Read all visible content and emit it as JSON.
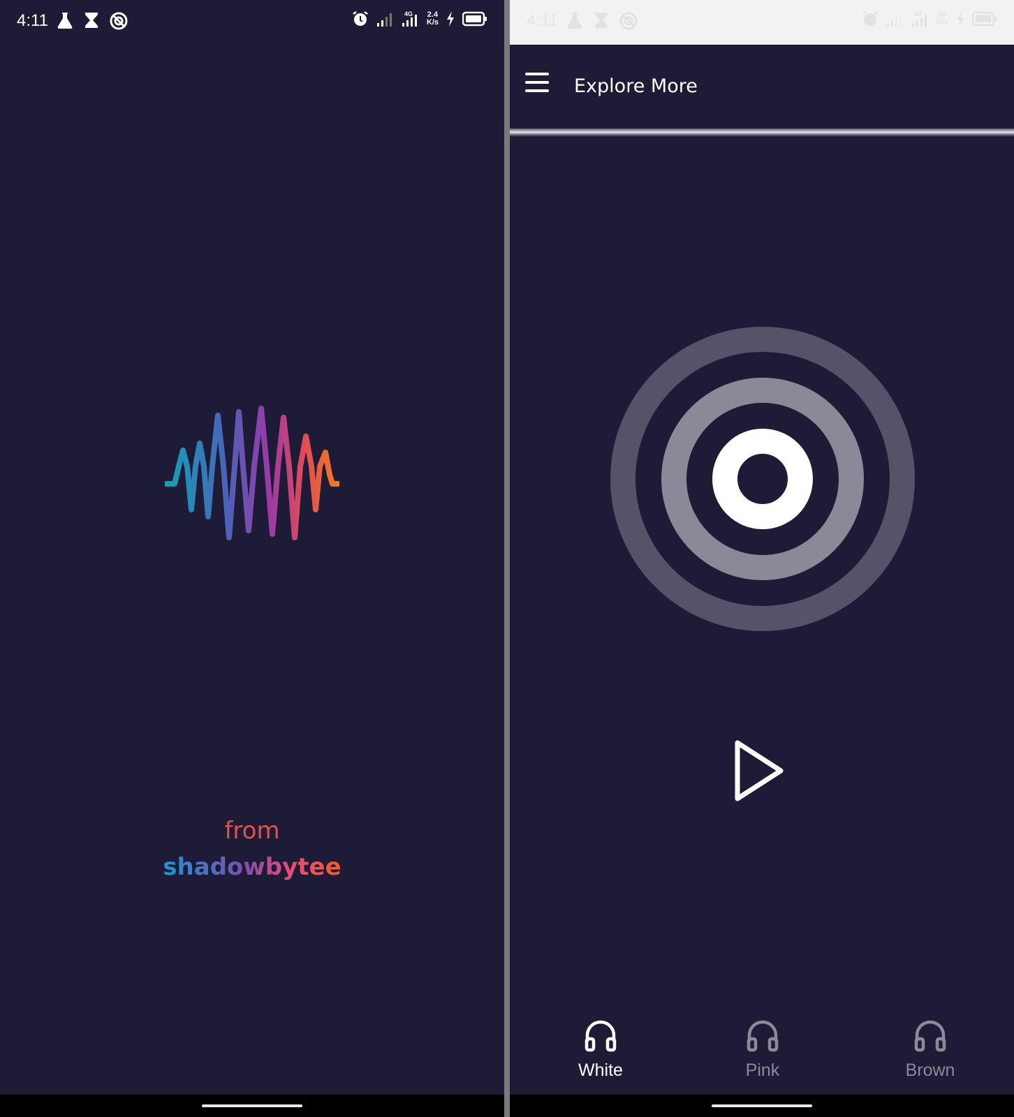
{
  "status_bar_left": {
    "time": "4:11",
    "icons": [
      "flask-icon",
      "hourglass-icon",
      "no-disturb-icon"
    ],
    "right_icons": [
      "alarm-icon",
      "signal-icon",
      "signal-4g-icon",
      "charging-icon",
      "battery-icon"
    ],
    "speed_line1": "2.4",
    "speed_line2": "K/s"
  },
  "status_bar_right": {
    "time": "4:11",
    "speed_line1": "66",
    "speed_line2": "B/s"
  },
  "splash": {
    "logo_icon": "sound-wave-logo",
    "from_label": "from",
    "brand_name": "shadowbytee",
    "colors": {
      "background": "#1e1b36",
      "from": "#e0514f",
      "gradient_start": "#1c96d4",
      "gradient_end": "#ef5b30"
    }
  },
  "app": {
    "appbar": {
      "title": "Explore More",
      "menu_icon": "hamburger-icon"
    },
    "visualizer_icon": "concentric-rings-icon",
    "play_icon": "play-icon",
    "tabs": [
      {
        "label": "White",
        "icon": "headphones-icon",
        "active": true
      },
      {
        "label": "Pink",
        "icon": "headphones-icon",
        "active": false
      },
      {
        "label": "Brown",
        "icon": "headphones-icon",
        "active": false
      }
    ],
    "colors": {
      "active": "#ffffff",
      "inactive": "#8b8a98",
      "ring_outer": "#55536a",
      "ring_middle": "#8a8998"
    }
  }
}
